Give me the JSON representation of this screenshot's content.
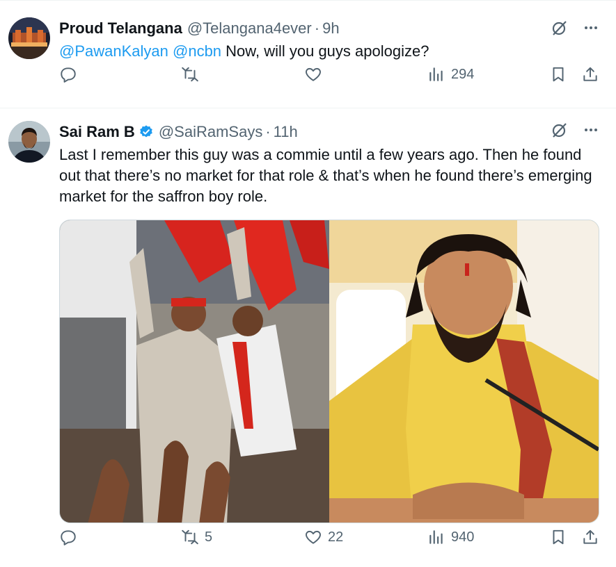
{
  "tweets": [
    {
      "name": "Proud Telangana",
      "handle": "@Telangana4ever",
      "separator": "·",
      "time": "9h",
      "mentions": [
        "@PawanKalyan",
        "@ncbn"
      ],
      "text": "Now, will you guys apologize?",
      "views": "294",
      "verified": false
    },
    {
      "name": "Sai Ram B",
      "handle": "@SaiRamSays",
      "separator": "·",
      "time": "11h",
      "text": "Last I remember this guy was a commie until a few years ago. Then he found out that there’s no market for that role & that’s when he found there’s emerging market for the saffron boy role.",
      "retweets": "5",
      "likes": "22",
      "views": "940",
      "verified": true
    }
  ],
  "colors": {
    "accent": "#1d9bf0",
    "secondary_text": "#536471",
    "primary_text": "#0f1419",
    "border": "#eff3f4"
  },
  "icons": {
    "reply": "reply-icon",
    "retweet": "retweet-icon",
    "like": "heart-icon",
    "views": "views-icon",
    "bookmark": "bookmark-icon",
    "share": "share-icon",
    "grok": "grok-icon",
    "more": "more-icon",
    "verified": "verified-badge-icon"
  }
}
